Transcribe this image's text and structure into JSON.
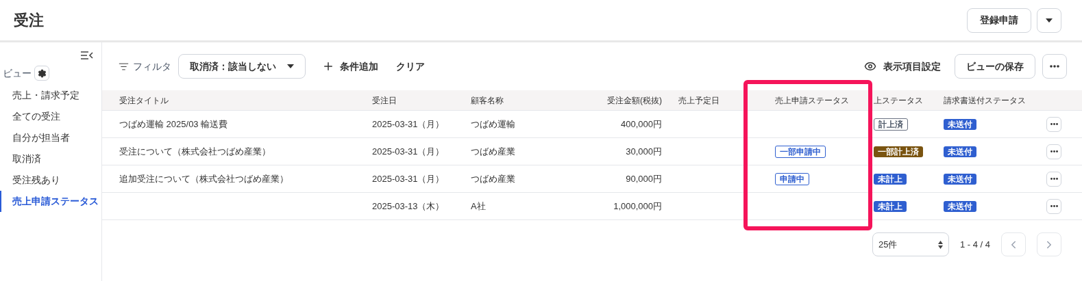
{
  "page": {
    "title": "受注",
    "buttons": [
      "登録申請"
    ]
  },
  "sidebar": {
    "heading": "ビュー",
    "items": [
      {
        "label": "売上・請求予定",
        "selected": false
      },
      {
        "label": "全ての受注",
        "selected": false
      },
      {
        "label": "自分が担当者",
        "selected": false
      },
      {
        "label": "取消済",
        "selected": false
      },
      {
        "label": "受注残あり",
        "selected": false
      },
      {
        "label": "売上申請ステータス",
        "selected": true
      }
    ]
  },
  "toolbar": {
    "filter_label": "フィルタ",
    "filter_chip": "取消済：該当しない",
    "add_condition": "条件追加",
    "clear": "クリア",
    "column_settings": "表示項目設定",
    "save_view": "ビューの保存"
  },
  "table": {
    "columns": [
      {
        "label": "受注タイトル",
        "highlighted": false
      },
      {
        "label": "受注日",
        "highlighted": false
      },
      {
        "label": "顧客名称",
        "highlighted": false
      },
      {
        "label": "受注金額(税抜)",
        "highlighted": false
      },
      {
        "label": "売上予定日",
        "highlighted": false
      },
      {
        "label": "売上申請ステータス",
        "highlighted": true
      },
      {
        "label": "上ステータス",
        "highlighted": false
      },
      {
        "label": "請求書送付ステータス",
        "highlighted": false
      }
    ],
    "rows": [
      {
        "title": "つばめ運輸 2025/03 輸送費",
        "date": "2025-03-31（月）",
        "customer": "つばめ運輸",
        "amount": "400,000円",
        "sales_status": {
          "label": "計上済",
          "kind": "outline"
        },
        "invoice_status": {
          "label": "未送付",
          "kind": "blue"
        }
      },
      {
        "title": "受注について（株式会社つばめ産業）",
        "date": "2025-03-31（月）",
        "customer": "つばめ産業",
        "amount": "30,000円",
        "request_status": {
          "label": "一部申請中",
          "kind": "outline-blue"
        },
        "sales_status": {
          "label": "一部計上済",
          "kind": "brown"
        },
        "invoice_status": {
          "label": "未送付",
          "kind": "blue"
        }
      },
      {
        "title": "追加受注について（株式会社つばめ産業）",
        "date": "2025-03-31（月）",
        "customer": "つばめ産業",
        "amount": "90,000円",
        "request_status": {
          "label": "申請中",
          "kind": "outline-blue"
        },
        "sales_status": {
          "label": "未計上",
          "kind": "blue"
        },
        "invoice_status": {
          "label": "未送付",
          "kind": "blue"
        }
      },
      {
        "date": "2025-03-13（木）",
        "customer": "A社",
        "amount": "1,000,000円",
        "sales_status": {
          "label": "未計上",
          "kind": "blue"
        },
        "invoice_status": {
          "label": "未送付",
          "kind": "blue"
        }
      }
    ]
  },
  "pagination": {
    "page_size": "25件",
    "range": "1 - 4 / 4"
  }
}
